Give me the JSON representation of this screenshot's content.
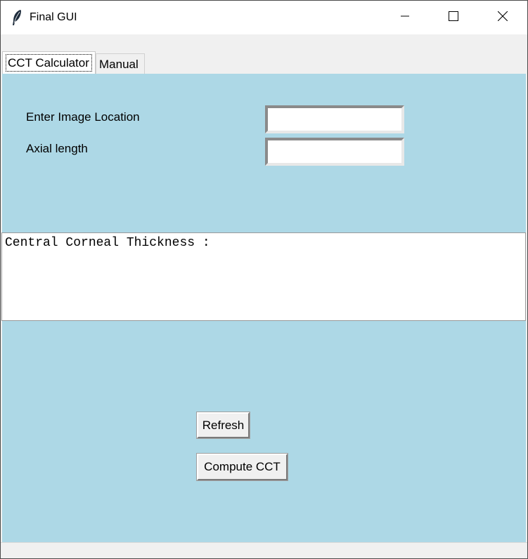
{
  "window": {
    "title": "Final GUI",
    "app_icon": "feather-icon",
    "controls": [
      "minimize-icon",
      "maximize-icon",
      "close-icon"
    ]
  },
  "tabs": [
    {
      "label": "CCT Calculator",
      "selected": true
    },
    {
      "label": "Manual",
      "selected": false
    }
  ],
  "form": {
    "image_location_label": "Enter Image Location",
    "image_location_value": "",
    "axial_length_label": "Axial length",
    "axial_length_value": ""
  },
  "result": {
    "text": "Central Corneal Thickness :"
  },
  "buttons": {
    "refresh_label": "Refresh",
    "compute_label": "Compute CCT"
  },
  "colors": {
    "panel_background": "#add8e6",
    "window_background": "#f0f0f0",
    "titlebar_background": "#ffffff"
  }
}
